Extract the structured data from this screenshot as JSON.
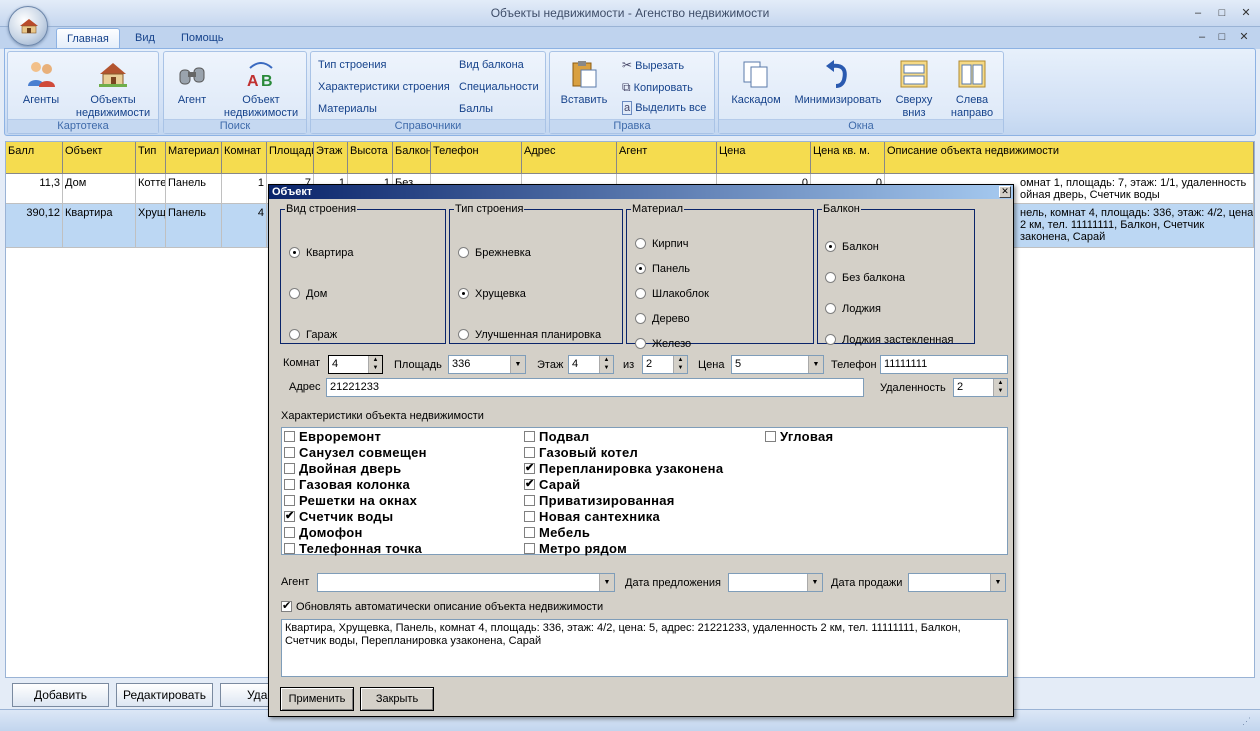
{
  "app": {
    "title": "Объекты недвижимости - Агенство недвижимости",
    "window_buttons": [
      "–",
      "□",
      "✕"
    ]
  },
  "tabs": [
    {
      "label": "Главная",
      "active": true
    },
    {
      "label": "Вид",
      "active": false
    },
    {
      "label": "Помощь",
      "active": false
    }
  ],
  "ribbon": {
    "groups": {
      "kartoteka": "Картотека",
      "poisk": "Поиск",
      "spravochniki": "Справочники",
      "pravka": "Правка",
      "okna": "Окна"
    },
    "agents": "Агенты",
    "objects": "Объекты недвижимости",
    "agent": "Агент",
    "object": "Объект недвижимости",
    "ref": {
      "building_type": "Тип строения",
      "building_chars": "Характеристики строения",
      "materials": "Материалы",
      "balcony_type": "Вид балкона",
      "specialties": "Специальности",
      "points": "Баллы"
    },
    "paste": "Вставить",
    "cut": "Вырезать",
    "copy": "Копировать",
    "select_all": "Выделить все",
    "cascade": "Каскадом",
    "minimize": "Минимизировать",
    "top_down": "Сверху вниз",
    "left_right": "Слева направо"
  },
  "grid": {
    "columns": [
      "Балл",
      "Объект",
      "Тип",
      "Материал",
      "Комнат",
      "Площадь",
      "Этаж",
      "Высота",
      "Балкон",
      "Телефон",
      "Адрес",
      "Агент",
      "Цена",
      "Цена кв. м.",
      "Описание объекта недвижимости"
    ],
    "rows": [
      {
        "ball": "11,3",
        "object": "Дом",
        "type": "Котте",
        "material": "Панель",
        "rooms": "1",
        "area": "7",
        "floor": "1",
        "height": "1",
        "balcony": "Без",
        "phone": "",
        "address": "",
        "agent": "",
        "price": "0",
        "price_m": "0",
        "description_visible": "омнат 1, площадь: 7, этаж: 1/1, удаленность",
        "description_visible2": "ойная дверь, Счетчик воды"
      },
      {
        "ball": "390,12",
        "object": "Квартира",
        "type": "Хрущ",
        "material": "Панель",
        "rooms": "4",
        "description_visible": "нель, комнат 4, площадь: 336, этаж: 4/2, цена:",
        "description_visible2": "2 км, тел. 11111111, Балкон, Счетчик",
        "description_visible3": "законена, Сарай"
      }
    ]
  },
  "bottom_buttons": {
    "add": "Добавить",
    "edit": "Редактировать",
    "delete_partial": "Уда"
  },
  "dialog": {
    "title": "Объект",
    "close": "✕",
    "vid_stroeniya": {
      "legend": "Вид строения",
      "options": [
        "Квартира",
        "Дом",
        "Гараж"
      ],
      "selected": 0
    },
    "tip_stroeniya": {
      "legend": "Тип строения",
      "options": [
        "Брежневка",
        "Хрущевка",
        "Улучшенная планировка"
      ],
      "selected": 1
    },
    "material": {
      "legend": "Материал",
      "options": [
        "Кирпич",
        "Панель",
        "Шлакоблок",
        "Дерево",
        "Железо"
      ],
      "selected": 1
    },
    "balkon": {
      "legend": "Балкон",
      "options": [
        "Балкон",
        "Без балкона",
        "Лоджия",
        "Лоджия застекленная"
      ],
      "selected": 0
    },
    "fields": {
      "rooms_label": "Комнат",
      "rooms": "4",
      "area_label": "Площадь",
      "area": "336",
      "floor_label": "Этаж",
      "floor": "4",
      "of_label": "из",
      "of": "2",
      "price_label": "Цена",
      "price": "5",
      "phone_label": "Телефон",
      "phone": "11111111",
      "address_label": "Адрес",
      "address": "21221233",
      "distance_label": "Удаленность",
      "distance": "2"
    },
    "chars_label": "Характеристики объекта недвижимости",
    "chars": [
      {
        "label": "Евроремонт",
        "checked": false
      },
      {
        "label": "Санузел совмещен",
        "checked": false
      },
      {
        "label": "Двойная дверь",
        "checked": false
      },
      {
        "label": "Газовая колонка",
        "checked": false
      },
      {
        "label": "Решетки на окнах",
        "checked": false
      },
      {
        "label": "Счетчик воды",
        "checked": true
      },
      {
        "label": "Домофон",
        "checked": false
      },
      {
        "label": "Телефонная точка",
        "checked": false
      },
      {
        "label": "Подвал",
        "checked": false
      },
      {
        "label": "Газовый котел",
        "checked": false
      },
      {
        "label": "Перепланировка узаконена",
        "checked": true
      },
      {
        "label": "Сарай",
        "checked": true
      },
      {
        "label": "Приватизированная",
        "checked": false
      },
      {
        "label": "Новая сантехника",
        "checked": false
      },
      {
        "label": "Мебель",
        "checked": false
      },
      {
        "label": "Метро рядом",
        "checked": false
      },
      {
        "label": "Угловая",
        "checked": false
      }
    ],
    "agent_label": "Агент",
    "agent": "",
    "offer_date_label": "Дата предложения",
    "offer_date": "",
    "sale_date_label": "Дата продажи",
    "sale_date": "",
    "auto_update_label": "Обновлять автоматически описание объекта недвижимости",
    "auto_update": true,
    "description": "Квартира, Хрущевка, Панель, комнат 4, площадь: 336, этаж: 4/2, цена: 5, адрес: 21221233, удаленность 2 км, тел. 11111111, Балкон, Счетчик воды, Перепланировка узаконена, Сарай",
    "apply": "Применить",
    "close_btn": "Закрыть"
  }
}
